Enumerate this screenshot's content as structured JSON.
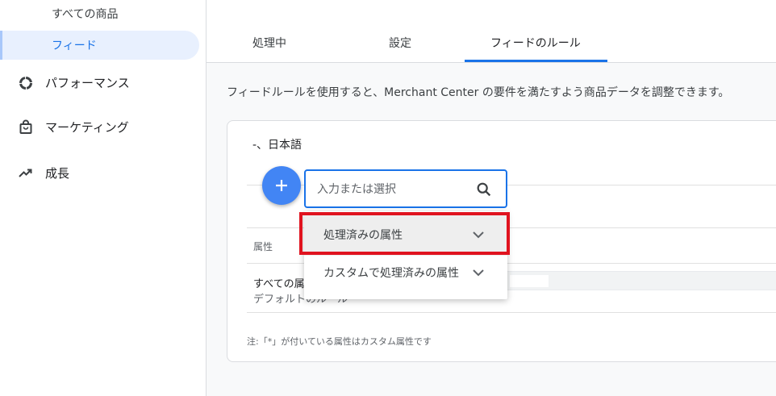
{
  "sidebar": {
    "sub_items": [
      {
        "label": "すべての商品"
      },
      {
        "label": "フィード"
      }
    ],
    "items": [
      {
        "label": "パフォーマンス",
        "icon": "performance-icon"
      },
      {
        "label": "マーケティング",
        "icon": "shopping-bag-icon"
      },
      {
        "label": "成長",
        "icon": "trending-up-icon"
      }
    ]
  },
  "tabs": [
    {
      "label": "処理中"
    },
    {
      "label": "設定"
    },
    {
      "label": "フィードのルール",
      "active": true
    }
  ],
  "description": "フィードルールを使用すると、Merchant Center の要件を満たすよう商品データを調整できます。",
  "card": {
    "title": "-、日本語",
    "column_header": "属性",
    "row_line1": "すべての属",
    "row_line2": "デフォルトのルール",
    "note": "注:「*」が付いている属性はカスタム属性です"
  },
  "search": {
    "placeholder": "入力または選択",
    "value": ""
  },
  "dropdown": {
    "items": [
      {
        "label": "処理済みの属性",
        "highlighted": true
      },
      {
        "label": "カスタムで処理済みの属性"
      }
    ]
  },
  "colors": {
    "accent": "#1a73e8",
    "fab": "#4285f4",
    "annotation": "#e0131f",
    "active_nav_bg": "#e8f0fe"
  }
}
